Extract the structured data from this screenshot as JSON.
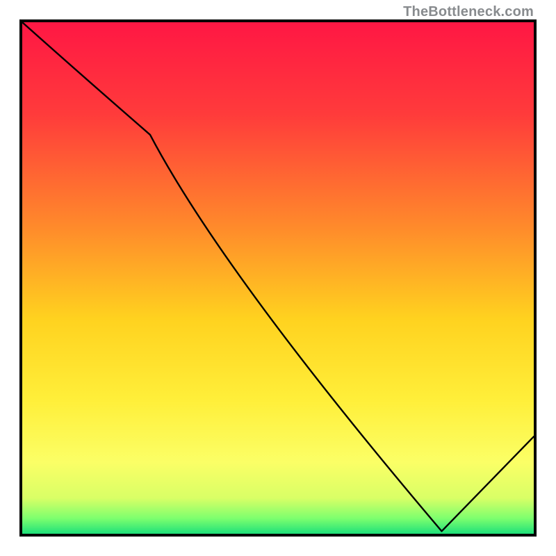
{
  "watermark": "TheBottleneck.com",
  "baseline_label": "",
  "gradient_stops": [
    {
      "pct": 0,
      "color": "#ff1744"
    },
    {
      "pct": 18,
      "color": "#ff3b3b"
    },
    {
      "pct": 40,
      "color": "#ff8a2b"
    },
    {
      "pct": 58,
      "color": "#ffd21f"
    },
    {
      "pct": 74,
      "color": "#ffef3a"
    },
    {
      "pct": 86,
      "color": "#fbff66"
    },
    {
      "pct": 93,
      "color": "#d9ff66"
    },
    {
      "pct": 97,
      "color": "#7dff6e"
    },
    {
      "pct": 100,
      "color": "#1ee07a"
    }
  ],
  "chart_data": {
    "type": "line",
    "title": "",
    "xlabel": "",
    "ylabel": "",
    "xlim": [
      0,
      100
    ],
    "ylim": [
      0,
      100
    ],
    "x": [
      0,
      25,
      82,
      100
    ],
    "values": [
      100,
      78,
      0.5,
      19
    ],
    "note": "Curve starts at top-left, bends near x≈25, descends to a minimum near x≈82 at the bottom, then rises toward the right edge."
  }
}
